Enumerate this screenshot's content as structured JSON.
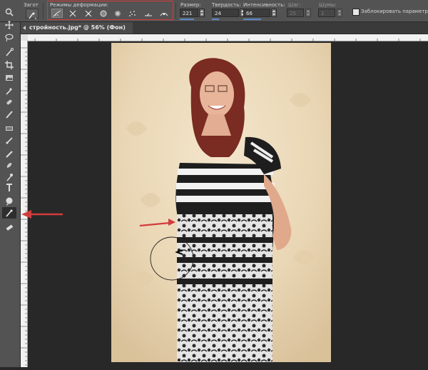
{
  "options_bar": {
    "presets_label": "Загот",
    "modes_label": "Режимы деформации:",
    "modes": [
      "forward-warp",
      "twirl",
      "pucker",
      "bloat",
      "push-left",
      "mirror",
      "turbulence",
      "reconstruct",
      "smooth"
    ],
    "size_label": "Размер:",
    "size_value": "221",
    "hardness_label": "Твердость:",
    "hardness_value": "24",
    "intensity_label": "Интенсивность:",
    "intensity_value": "66",
    "step_label": "Шаг:",
    "step_value": "25",
    "noise_label": "Шумы:",
    "noise_value": "1",
    "lock_label": "Заблокировать параметры"
  },
  "document_tab": {
    "title": "стройность.jpg* @ 56% (Фон)"
  },
  "toolbar": {
    "tools": [
      "zoom-icon",
      "move-icon",
      "lasso-icon",
      "quick-selection-icon",
      "crop-icon",
      "frame-icon",
      "eyedropper-icon",
      "healing-icon",
      "brush-icon",
      "stamp-icon",
      "history-brush-icon",
      "eraser-icon",
      "gradient-icon",
      "blur-icon",
      "dodge-icon",
      "pen-icon",
      "type-icon",
      "shape-icon",
      "hand-icon",
      "warp-brush-icon",
      "eraser-small-icon"
    ]
  },
  "colors": {
    "panel": "#535353",
    "canvas_bg": "#282828",
    "highlight_red": "#d23c3c",
    "accent_blue": "#5d89c7"
  }
}
